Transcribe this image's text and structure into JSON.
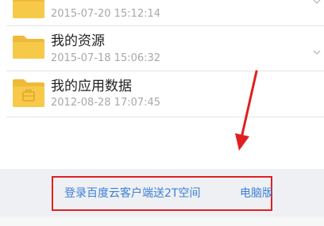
{
  "files": [
    {
      "name": "",
      "date": "2015-07-20 15:12:14",
      "icon": "folder-icon"
    },
    {
      "name": "我的资源",
      "date": "2015-07-18 15:06:32",
      "icon": "folder-icon"
    },
    {
      "name": "我的应用数据",
      "date": "2012-08-28 17:07:45",
      "icon": "app-folder-icon"
    }
  ],
  "footer": {
    "login_link": "登录百度云客户端送2T空间",
    "pc_link": "电脑版"
  },
  "colors": {
    "folder": "#f5c242",
    "link": "#3d7fd8",
    "annotation": "#e02020"
  }
}
